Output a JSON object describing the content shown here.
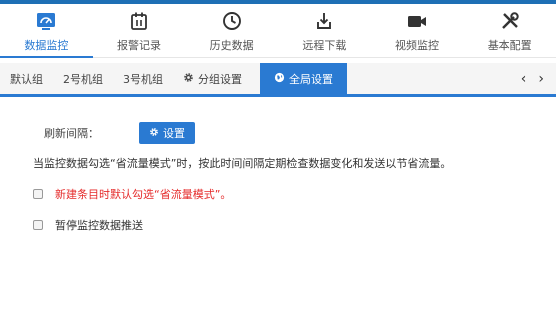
{
  "nav": {
    "items": [
      {
        "label": "数据监控",
        "icon": "dashboard-icon"
      },
      {
        "label": "报警记录",
        "icon": "calendar-icon"
      },
      {
        "label": "历史数据",
        "icon": "history-icon"
      },
      {
        "label": "远程下载",
        "icon": "download-icon"
      },
      {
        "label": "视频监控",
        "icon": "video-camera-icon"
      },
      {
        "label": "基本配置",
        "icon": "tools-icon"
      }
    ],
    "active": "数据监控"
  },
  "tabs": {
    "items": [
      "默认组",
      "2号机组",
      "3号机组",
      "分组设置",
      "全局设置"
    ],
    "active": "全局设置",
    "prev": "‹",
    "next": "›"
  },
  "settings": {
    "refresh_label": "刷新间隔：",
    "set_button": "设置",
    "description": "当监控数据勾选“省流量模式”时，按此时间间隔定期检查数据变化和发送以节省流量。",
    "checkbox_new_item": "新建条目时默认勾选“省流量模式”。",
    "checkbox_pause_push": "暂停监控数据推送"
  },
  "colors": {
    "accent": "#2a7ad2",
    "warning": "#e52b2b",
    "topline": "#1e6fb5"
  }
}
